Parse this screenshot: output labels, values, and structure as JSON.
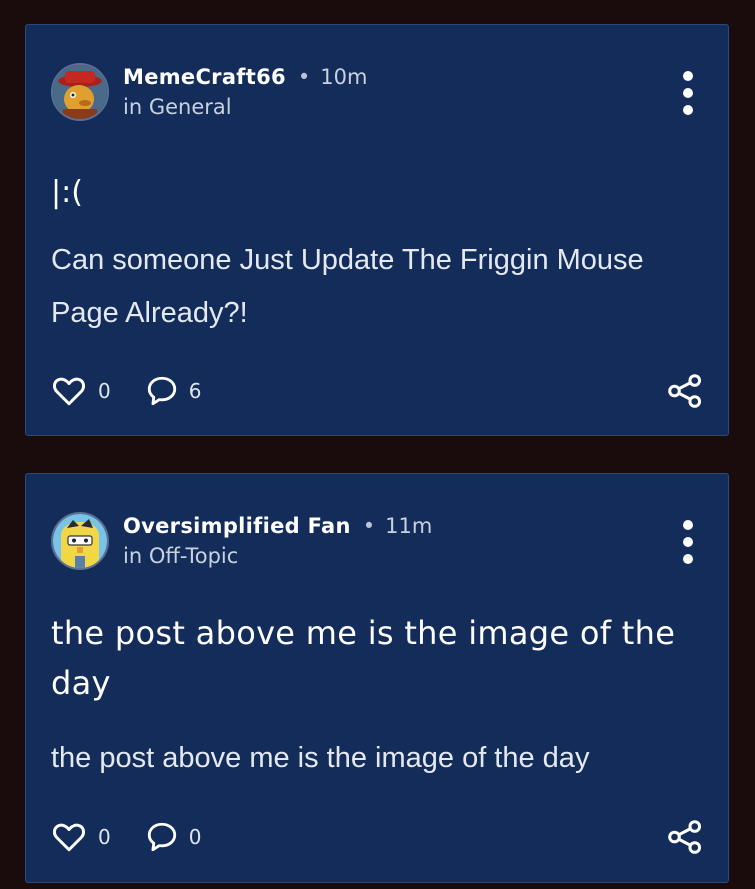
{
  "posts": [
    {
      "author": "MemeCraft66",
      "time": "10m",
      "category": "in General",
      "title": "|:(",
      "body": "Can someone Just Update The Friggin Mouse Page Already?!",
      "likes": "0",
      "comments": "6",
      "avatar_icon": "red-hat-character-avatar"
    },
    {
      "author": "Oversimplified Fan",
      "time": "11m",
      "category": "in Off-Topic",
      "title": "the post above me is the image of the day",
      "body": "the post above me is the image of the day",
      "likes": "0",
      "comments": "0",
      "avatar_icon": "yellow-cartoon-character-avatar"
    }
  ],
  "colors": {
    "page_background": "#1a0c0d",
    "card_background": "#132c5a",
    "card_border": "#2a4a7d",
    "text_primary": "#ffffff",
    "text_secondary": "#c8d1df"
  },
  "icons": {
    "like": "heart-icon",
    "comment": "comment-bubble-icon",
    "share": "share-icon",
    "menu": "more-vertical-icon"
  }
}
